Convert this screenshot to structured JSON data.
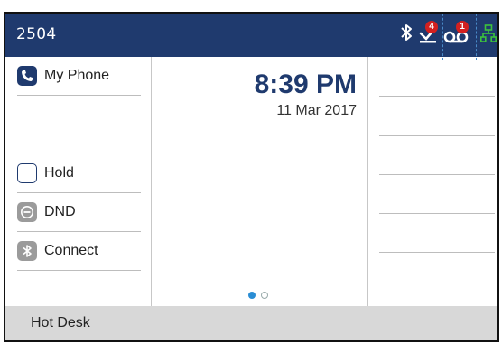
{
  "header": {
    "extension": "2504",
    "icons": {
      "bluetooth": "bluetooth-icon",
      "missed_calls": {
        "icon": "missed-call-icon",
        "count": "4"
      },
      "voicemail": {
        "icon": "voicemail-icon",
        "count": "1"
      },
      "network": "network-icon"
    },
    "colors": {
      "bar": "#1f3a6e",
      "badge": "#d32020",
      "network": "#3cc23c"
    }
  },
  "line_keys": [
    {
      "label": "My Phone",
      "icon": "phone-icon"
    },
    {
      "label": "",
      "icon": ""
    },
    {
      "label": "Hold",
      "icon": "hold-icon"
    },
    {
      "label": "DND",
      "icon": "dnd-icon"
    },
    {
      "label": "Connect",
      "icon": "bluetooth-icon"
    }
  ],
  "clock": {
    "time": "8:39 PM",
    "date": "11 Mar 2017"
  },
  "pager": {
    "pages": 2,
    "current": 1
  },
  "softkeys": [
    {
      "label": "Hot Desk"
    }
  ]
}
